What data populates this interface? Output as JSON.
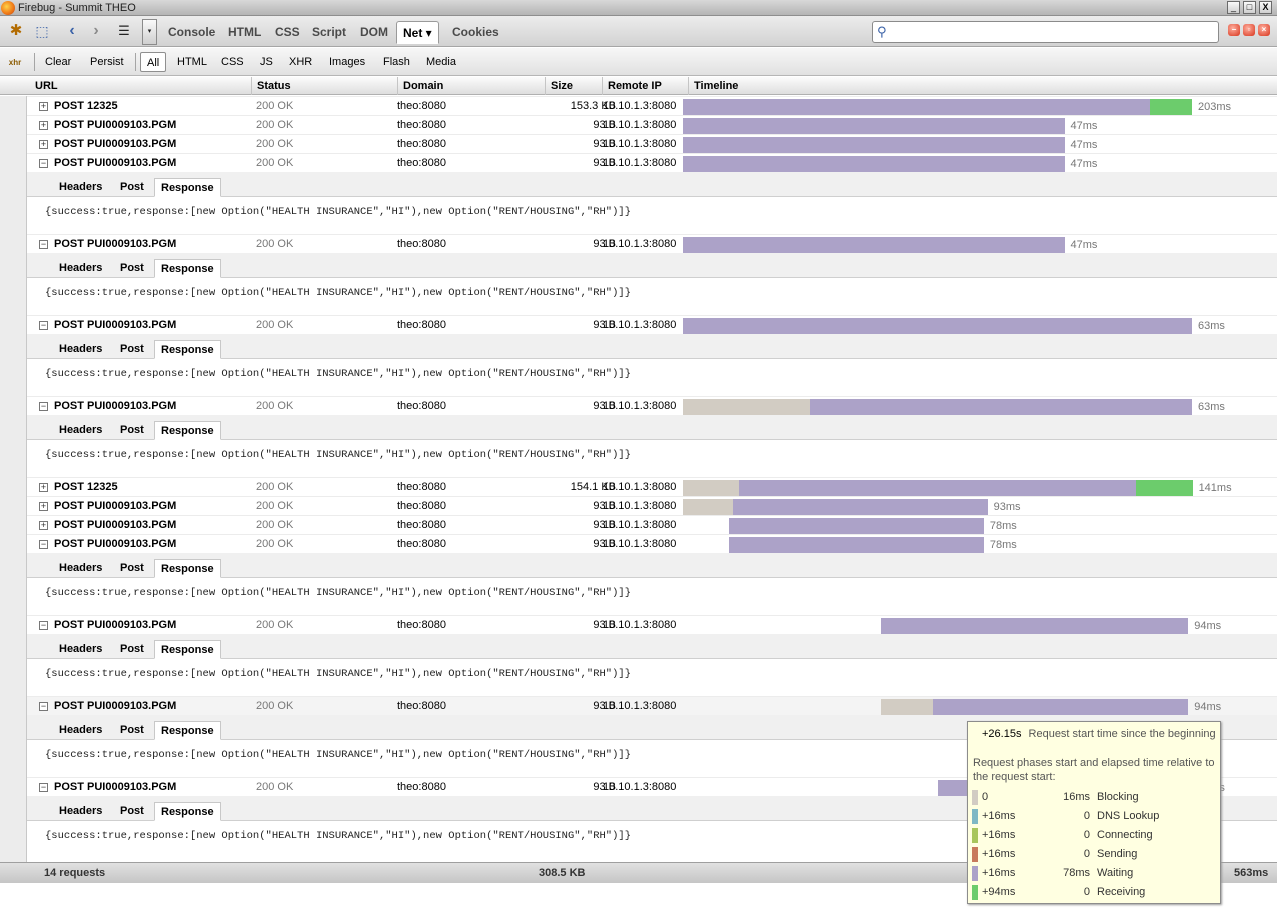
{
  "window": {
    "title": "Firebug - Summit THEO",
    "min_label": "_",
    "max_label": "□",
    "close_label": "X"
  },
  "toolbar": {
    "menu_drop_label": "▾",
    "panel_tabs": [
      {
        "label": "Console"
      },
      {
        "label": "HTML"
      },
      {
        "label": "CSS"
      },
      {
        "label": "Script"
      },
      {
        "label": "DOM"
      },
      {
        "label": "Net ▾",
        "active": true
      },
      {
        "label": "Cookies"
      }
    ],
    "search": {
      "placeholder": "",
      "value": ""
    }
  },
  "filterbar": {
    "clear": "Clear",
    "persist": "Persist",
    "filters": [
      "All",
      "HTML",
      "CSS",
      "JS",
      "XHR",
      "Images",
      "Flash",
      "Media"
    ],
    "selected": "All"
  },
  "columns": [
    "URL",
    "Status",
    "Domain",
    "Size",
    "Remote IP",
    "Timeline"
  ],
  "requests": [
    {
      "toggle": "+",
      "url": "POST 12325",
      "status": "200 OK",
      "domain": "theo:8080",
      "size": "153.3 KB",
      "ip": "10.10.1.3:8080",
      "block": 0,
      "wait": 0.857,
      "recv": 0.077,
      "offset": 0,
      "time": "203ms",
      "expanded": false
    },
    {
      "toggle": "+",
      "url": "POST PUI0009103.PGM",
      "status": "200 OK",
      "domain": "theo:8080",
      "size": "93 B",
      "ip": "10.10.1.3:8080",
      "block": 0,
      "wait": 0.7,
      "recv": 0,
      "offset": 0,
      "time": "47ms",
      "expanded": false
    },
    {
      "toggle": "+",
      "url": "POST PUI0009103.PGM",
      "status": "200 OK",
      "domain": "theo:8080",
      "size": "93 B",
      "ip": "10.10.1.3:8080",
      "block": 0,
      "wait": 0.7,
      "recv": 0,
      "offset": 0,
      "time": "47ms",
      "expanded": false
    },
    {
      "toggle": "−",
      "url": "POST PUI0009103.PGM",
      "status": "200 OK",
      "domain": "theo:8080",
      "size": "93 B",
      "ip": "10.10.1.3:8080",
      "block": 0,
      "wait": 0.7,
      "recv": 0,
      "offset": 0,
      "time": "47ms",
      "expanded": true
    },
    {
      "toggle": "−",
      "url": "POST PUI0009103.PGM",
      "status": "200 OK",
      "domain": "theo:8080",
      "size": "93 B",
      "ip": "10.10.1.3:8080",
      "block": 0,
      "wait": 0.7,
      "recv": 0,
      "offset": 0,
      "time": "47ms",
      "expanded": true
    },
    {
      "toggle": "−",
      "url": "POST PUI0009103.PGM",
      "status": "200 OK",
      "domain": "theo:8080",
      "size": "93 B",
      "ip": "10.10.1.3:8080",
      "block": 0,
      "wait": 0.934,
      "recv": 0,
      "offset": 0,
      "time": "63ms",
      "expanded": true
    },
    {
      "toggle": "−",
      "url": "POST PUI0009103.PGM",
      "status": "200 OK",
      "domain": "theo:8080",
      "size": "93 B",
      "ip": "10.10.1.3:8080",
      "block": 0.233,
      "wait": 0.701,
      "recv": 0,
      "offset": 0,
      "time": "63ms",
      "expanded": true
    },
    {
      "toggle": "+",
      "url": "POST 12325",
      "status": "200 OK",
      "domain": "theo:8080",
      "size": "154.1 KB",
      "ip": "10.10.1.3:8080",
      "block": 0.103,
      "wait": 0.729,
      "recv": 0.103,
      "offset": 0,
      "time": "141ms",
      "expanded": false
    },
    {
      "toggle": "+",
      "url": "POST PUI0009103.PGM",
      "status": "200 OK",
      "domain": "theo:8080",
      "size": "93 B",
      "ip": "10.10.1.3:8080",
      "block": 0.091,
      "wait": 0.468,
      "recv": 0,
      "offset": 0,
      "time": "93ms",
      "expanded": false
    },
    {
      "toggle": "+",
      "url": "POST PUI0009103.PGM",
      "status": "200 OK",
      "domain": "theo:8080",
      "size": "93 B",
      "ip": "10.10.1.3:8080",
      "block": 0,
      "wait": 0.468,
      "recv": 0,
      "offset": 0.084,
      "time": "78ms",
      "expanded": false
    },
    {
      "toggle": "−",
      "url": "POST PUI0009103.PGM",
      "status": "200 OK",
      "domain": "theo:8080",
      "size": "93 B",
      "ip": "10.10.1.3:8080",
      "block": 0,
      "wait": 0.468,
      "recv": 0,
      "offset": 0.084,
      "time": "78ms",
      "expanded": true
    },
    {
      "toggle": "−",
      "url": "POST PUI0009103.PGM",
      "status": "200 OK",
      "domain": "theo:8080",
      "size": "93 B",
      "ip": "10.10.1.3:8080",
      "block": 0,
      "wait": 0.563,
      "recv": 0,
      "offset": 0.364,
      "time": "94ms",
      "expanded": true
    },
    {
      "toggle": "−",
      "url": "POST PUI0009103.PGM",
      "status": "200 OK",
      "domain": "theo:8080",
      "size": "93 B",
      "ip": "10.10.1.3:8080",
      "block": 0.094,
      "wait": 0.469,
      "recv": 0,
      "offset": 0.364,
      "time": "94ms",
      "expanded": true,
      "hovered": true
    },
    {
      "toggle": "−",
      "url": "POST PUI0009103.PGM",
      "status": "200 OK",
      "domain": "theo:8080",
      "size": "93 B",
      "ip": "10.10.1.3:8080",
      "block": 0,
      "wait": 0.467,
      "recv": 0,
      "offset": 0.467,
      "time": "78ms",
      "expanded": true
    }
  ],
  "detail": {
    "tabs": [
      "Headers",
      "Post",
      "Response"
    ],
    "active_tab": "Response",
    "response_text": "{success:true,response:[new Option(\"HEALTH INSURANCE\",\"HI\"),new Option(\"RENT/HOUSING\",\"RH\")]}"
  },
  "summary": {
    "count": "14 requests",
    "size": "308.5 KB",
    "time": "563ms"
  },
  "tooltip": {
    "start_value": "+26.15s",
    "start_desc": "Request start time since the beginning",
    "desc": "Request phases start and elapsed time relative to the request start:",
    "phases": [
      {
        "start": "0",
        "elapsed": "16ms",
        "name": "Blocking",
        "color": "#d2ccc3"
      },
      {
        "start": "+16ms",
        "elapsed": "0",
        "name": "DNS Lookup",
        "color": "#7fb8c4"
      },
      {
        "start": "+16ms",
        "elapsed": "0",
        "name": "Connecting",
        "color": "#a8c65c"
      },
      {
        "start": "+16ms",
        "elapsed": "0",
        "name": "Sending",
        "color": "#c87a5c"
      },
      {
        "start": "+16ms",
        "elapsed": "78ms",
        "name": "Waiting",
        "color": "#aca2c8"
      },
      {
        "start": "+94ms",
        "elapsed": "0",
        "name": "Receiving",
        "color": "#6ccc6c"
      }
    ]
  },
  "colors": {
    "blocking": "#d2ccc3",
    "waiting": "#aca2c8",
    "receiving": "#6ccc6c",
    "tooltip_bg": "#ffffe1"
  }
}
